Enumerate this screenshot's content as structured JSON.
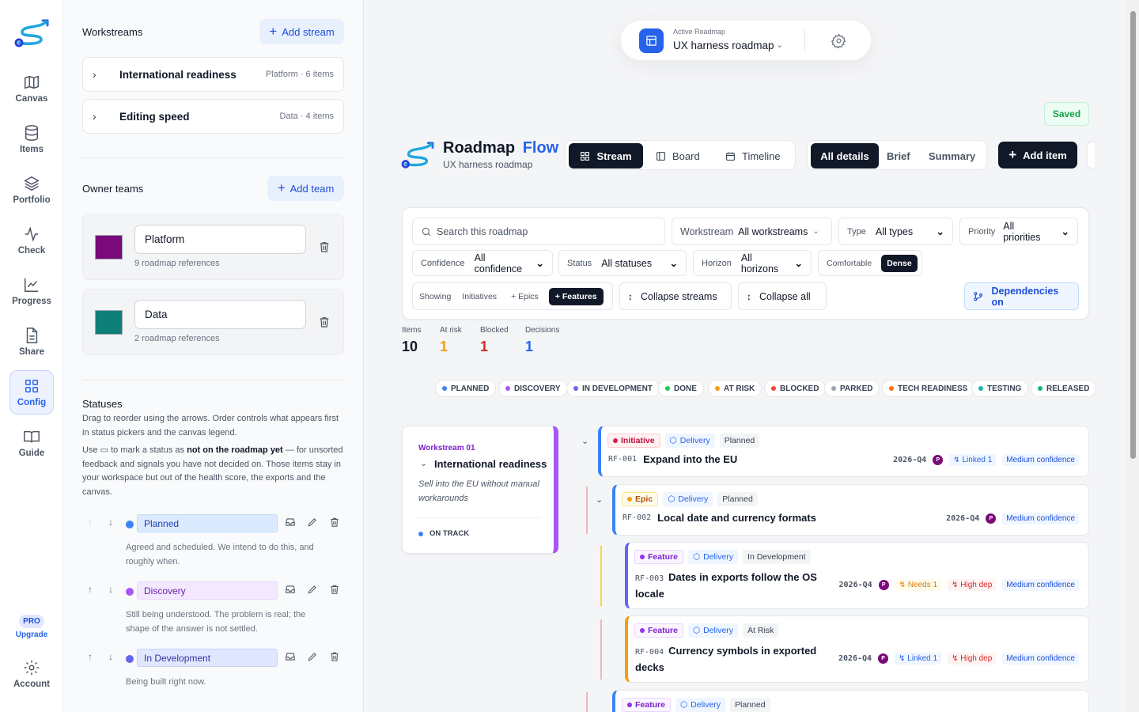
{
  "nav": {
    "items": [
      {
        "label": "Canvas",
        "icon": "map-icon"
      },
      {
        "label": "Items",
        "icon": "database-icon"
      },
      {
        "label": "Portfolio",
        "icon": "layers-icon"
      },
      {
        "label": "Check",
        "icon": "activity-icon"
      },
      {
        "label": "Progress",
        "icon": "chart-line-icon"
      },
      {
        "label": "Share",
        "icon": "document-icon"
      },
      {
        "label": "Config",
        "icon": "grid-icon"
      },
      {
        "label": "Guide",
        "icon": "book-icon"
      }
    ],
    "pro_badge": "PRO",
    "upgrade": "Upgrade",
    "account": "Account"
  },
  "workstreams": {
    "title": "Workstreams",
    "add_label": "Add stream",
    "items": [
      {
        "name": "International readiness",
        "meta": "Platform · 6 items"
      },
      {
        "name": "Editing speed",
        "meta": "Data · 4 items"
      }
    ]
  },
  "teams": {
    "title": "Owner teams",
    "add_label": "Add team",
    "items": [
      {
        "name": "Platform",
        "refs": "9 roadmap references",
        "color": "#7a0a7a"
      },
      {
        "name": "Data",
        "refs": "2 roadmap references",
        "color": "#0f7f7a"
      }
    ]
  },
  "statuses": {
    "title": "Statuses",
    "desc1": "Drag to reorder using the arrows. Order controls what appears first in status pickers and the canvas legend.",
    "desc2_a": "Use",
    "desc2_b": "to mark a status as",
    "desc2_bold": "not on the roadmap yet",
    "desc2_c": "— for unsorted feedback and signals you have not decided on. Those items stay in your workspace but out of the health score, the exports and the canvas.",
    "items": [
      {
        "name": "Planned",
        "desc": "Agreed and scheduled. We intend to do this, and roughly when.",
        "color": "#3b82f6",
        "bg": "#dbeafe",
        "fg": "#1e40af"
      },
      {
        "name": "Discovery",
        "desc": "Still being understood. The problem is real; the shape of the answer is not settled.",
        "color": "#a855f7",
        "bg": "#f3e8ff",
        "fg": "#6b21a8"
      },
      {
        "name": "In Development",
        "desc": "Being built right now.",
        "color": "#6366f1",
        "bg": "#e0e7ff",
        "fg": "#3730a3"
      }
    ]
  },
  "active_roadmap": {
    "label": "Active Roadmap",
    "name": "UX harness roadmap"
  },
  "saved": "Saved",
  "brand": {
    "word1": "Roadmap",
    "word2": "Flow",
    "subtitle": "UX harness roadmap"
  },
  "views": {
    "stream": "Stream",
    "board": "Board",
    "timeline": "Timeline"
  },
  "detail": {
    "all": "All details",
    "brief": "Brief",
    "summary": "Summary"
  },
  "add_item": "Add item",
  "filters": {
    "search_placeholder": "Search this roadmap",
    "workstream_label": "Workstream",
    "workstream_value": "All workstreams",
    "type_label": "Type",
    "type_value": "All types",
    "priority_label": "Priority",
    "priority_value": "All priorities",
    "confidence_label": "Confidence",
    "confidence_value": "All confidence",
    "status_label": "Status",
    "status_value": "All statuses",
    "horizon_label": "Horizon",
    "horizon_value": "All horizons",
    "density_comfortable": "Comfortable",
    "density_dense": "Dense",
    "showing_label": "Showing",
    "showing_initiatives": "Initiatives",
    "showing_epics": "+ Epics",
    "showing_features": "+ Features",
    "collapse_streams": "Collapse streams",
    "collapse_all": "Collapse all",
    "dependencies": "Dependencies on"
  },
  "stats": [
    {
      "label": "Items",
      "value": "10",
      "color": "#111827"
    },
    {
      "label": "At risk",
      "value": "1",
      "color": "#f59e0b"
    },
    {
      "label": "Blocked",
      "value": "1",
      "color": "#dc2626"
    },
    {
      "label": "Decisions",
      "value": "1",
      "color": "#2563eb"
    }
  ],
  "legend": [
    {
      "label": "PLANNED",
      "color": "#3b82f6"
    },
    {
      "label": "DISCOVERY",
      "color": "#a855f7"
    },
    {
      "label": "IN DEVELOPMENT",
      "color": "#6366f1"
    },
    {
      "label": "DONE",
      "color": "#22c55e"
    },
    {
      "label": "AT RISK",
      "color": "#f59e0b"
    },
    {
      "label": "BLOCKED",
      "color": "#ef4444"
    },
    {
      "label": "PARKED",
      "color": "#9ca3af"
    },
    {
      "label": "TECH READINESS",
      "color": "#f97316"
    },
    {
      "label": "TESTING",
      "color": "#14b8a6"
    },
    {
      "label": "RELEASED",
      "color": "#10b981"
    }
  ],
  "stream_card": {
    "kicker": "Workstream 01",
    "name": "International readiness",
    "desc": "Sell into the EU without manual workarounds",
    "status": "ON TRACK"
  },
  "items": [
    {
      "type": "Initiative",
      "lane": "Delivery",
      "status": "Planned",
      "id": "RF-001",
      "title": "Expand into the EU",
      "date": "2026-Q4",
      "avatar": "P",
      "chips": [
        "Linked 1",
        "Medium confidence"
      ]
    },
    {
      "type": "Epic",
      "lane": "Delivery",
      "status": "Planned",
      "id": "RF-002",
      "title": "Local date and currency formats",
      "date": "2026-Q4",
      "avatar": "P",
      "chips": [
        "Medium confidence"
      ]
    },
    {
      "type": "Feature",
      "lane": "Delivery",
      "status": "In Development",
      "id": "RF-003",
      "title1": "Dates in exports follow the OS",
      "title2": "locale",
      "date": "2026-Q4",
      "avatar": "P",
      "chips": [
        "Needs 1",
        "High dep",
        "Medium confidence"
      ]
    },
    {
      "type": "Feature",
      "lane": "Delivery",
      "status": "At Risk",
      "id": "RF-004",
      "title1": "Currency symbols in exported",
      "title2": "decks",
      "date": "2026-Q4",
      "avatar": "P",
      "chips": [
        "Linked 1",
        "High dep",
        "Medium confidence"
      ]
    },
    {
      "type": "Feature",
      "lane": "Delivery",
      "status": "Planned"
    }
  ]
}
